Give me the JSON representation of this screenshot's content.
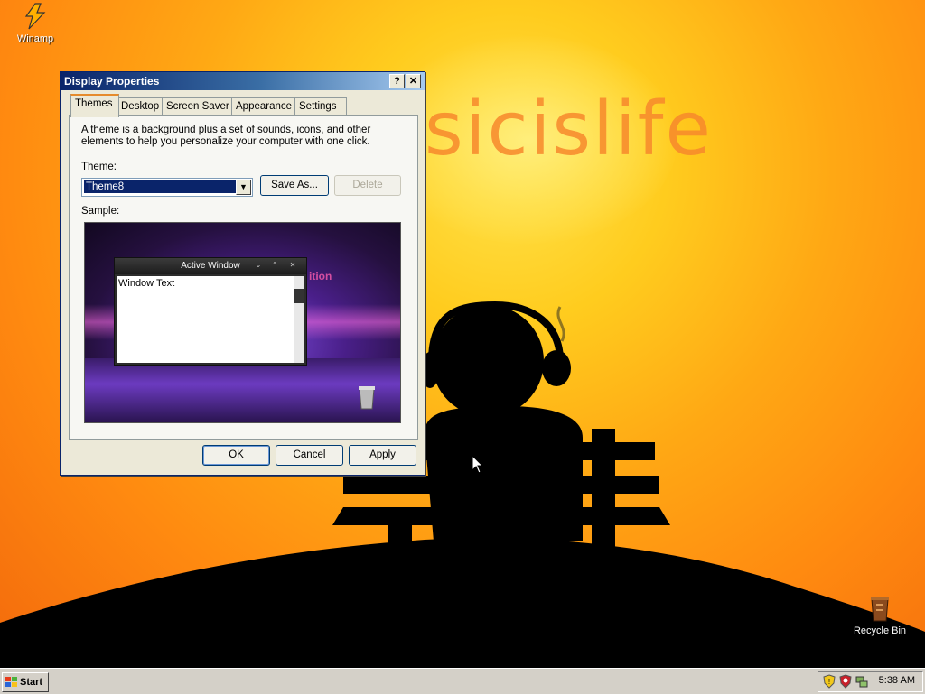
{
  "desktop": {
    "wallpaper_text": "sicislife",
    "icons": [
      {
        "label": "Winamp"
      },
      {
        "label": "Recycle Bin"
      }
    ]
  },
  "dialog": {
    "title": "Display Properties",
    "help_button": "?",
    "close_button": "✕",
    "tabs": [
      {
        "label": "Themes",
        "active": true
      },
      {
        "label": "Desktop"
      },
      {
        "label": "Screen Saver"
      },
      {
        "label": "Appearance"
      },
      {
        "label": "Settings"
      }
    ],
    "description": "A theme is a background plus a set of sounds, icons, and other elements to help you personalize your computer with one click.",
    "theme_label": "Theme:",
    "theme_value": "Theme8",
    "save_as_label": "Save As...",
    "delete_label": "Delete",
    "sample_label": "Sample:",
    "sample": {
      "active_window_title": "Active Window",
      "window_text": "Window Text",
      "brand_text": "ition"
    },
    "ok_label": "OK",
    "cancel_label": "Cancel",
    "apply_label": "Apply"
  },
  "taskbar": {
    "start_label": "Start",
    "clock": "5:38 AM"
  },
  "colors": {
    "title_start": "#0a246a",
    "title_end": "#a6caf0",
    "dialog_face": "#ece9d8",
    "wallpaper_orange": "#ff8a10"
  }
}
